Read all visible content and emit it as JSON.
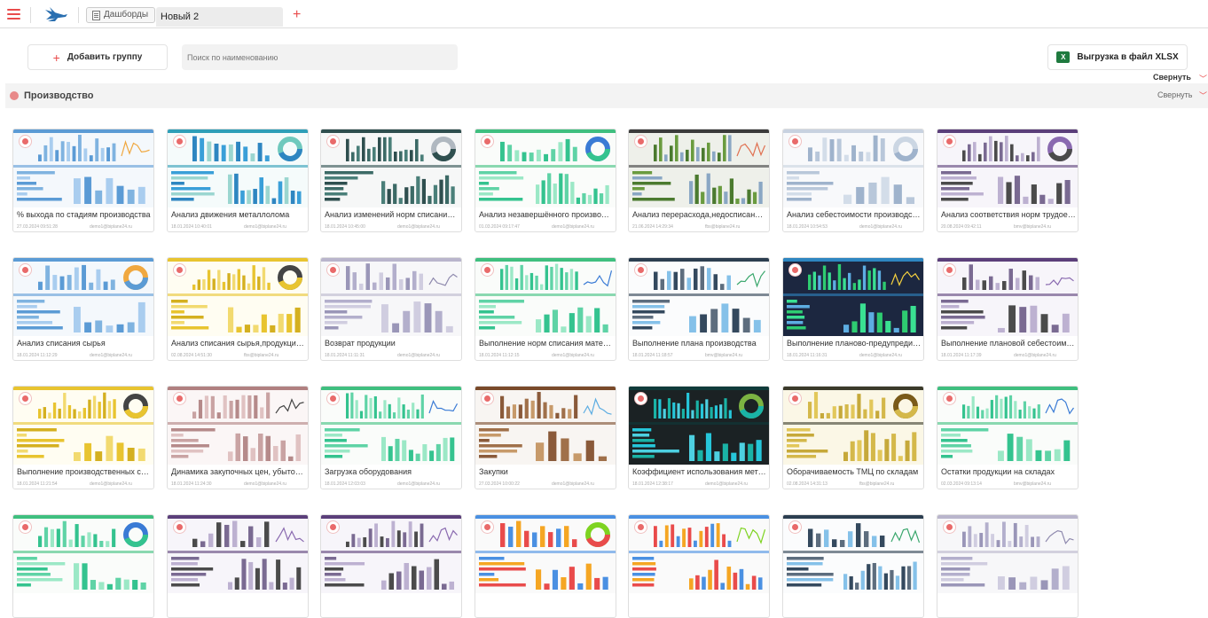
{
  "header": {
    "tabs": [
      {
        "label": "Дашборды"
      },
      {
        "label": "Новый 2"
      }
    ],
    "add_tab": "+"
  },
  "toolbar": {
    "add_group_label": "Добавить группу",
    "add_group_plus": "+",
    "search_placeholder": "Поиск по наименованию",
    "export_label": "Выгрузка в файл XLSX",
    "export_icon": "X",
    "collapse_all": "Свернуть",
    "chevron": "﹀"
  },
  "group": {
    "title": "Производство",
    "collapse": "Свернуть"
  },
  "colors": {
    "accent": "#e94b4b",
    "excel": "#1f7a3f"
  },
  "cards": [
    {
      "title": "% выхода по стадиям производства",
      "date": "27.03.2024 09:51:28",
      "author": "demo1@biplane24.ru",
      "theme": "blue"
    },
    {
      "title": "Анализ движения металлолома",
      "date": "18.01.2024 10:40:01",
      "author": "demo1@biplane24.ru",
      "theme": "teal"
    },
    {
      "title": "Анализ изменений норм списания сы...",
      "date": "18.01.2024 10:45:00",
      "author": "demo1@biplane24.ru",
      "theme": "dark"
    },
    {
      "title": "Анализ незавершённого производства",
      "date": "01.03.2024 09:17:47",
      "author": "demo1@biplane24.ru",
      "theme": "green"
    },
    {
      "title": "Анализ перерасхода,недосписания с...",
      "date": "21.06.2024 14:29:34",
      "author": "fbs@biplane24.ru",
      "theme": "olive"
    },
    {
      "title": "Анализ себестоимости производства...",
      "date": "18.01.2024 10:54:53",
      "author": "demo1@biplane24.ru",
      "theme": "light"
    },
    {
      "title": "Анализ соответствия норм трудоемк...",
      "date": "20.08.2024 09:42:11",
      "author": "bmv@biplane24.ru",
      "theme": "purple"
    },
    {
      "title": "Анализ списания сырья",
      "date": "18.01.2024 11:12:29",
      "author": "demo1@biplane24.ru",
      "theme": "blue"
    },
    {
      "title": "Анализ списания сырья,продукции с...",
      "date": "02.08.2024 14:51:30",
      "author": "fbs@biplane24.ru",
      "theme": "yellow"
    },
    {
      "title": "Возврат продукции",
      "date": "18.01.2024 11:11:31",
      "author": "demo1@biplane24.ru",
      "theme": "grey"
    },
    {
      "title": "Выполнение норм списания материа...",
      "date": "18.01.2024 11:12:15",
      "author": "demo1@biplane24.ru",
      "theme": "green"
    },
    {
      "title": "Выполнение плана производства",
      "date": "18.01.2024 11:18:57",
      "author": "bmv@biplane24.ru",
      "theme": "navy"
    },
    {
      "title": "Выполнение планово-предупредите...",
      "date": "18.01.2024 11:16:31",
      "author": "demo1@biplane24.ru",
      "theme": "darkblue"
    },
    {
      "title": "Выполнение плановой себестоимост...",
      "date": "18.01.2024 11:17:39",
      "author": "demo1@biplane24.ru",
      "theme": "purple"
    },
    {
      "title": "Выполнение производственных смен...",
      "date": "18.01.2024 11:21:54",
      "author": "demo1@biplane24.ru",
      "theme": "yellow"
    },
    {
      "title": "Динамика закупочных цен, убыток о...",
      "date": "18.01.2024 11:24:30",
      "author": "demo1@biplane24.ru",
      "theme": "pink"
    },
    {
      "title": "Загрузка оборудования",
      "date": "18.01.2024 12:03:03",
      "author": "demo1@biplane24.ru",
      "theme": "green"
    },
    {
      "title": "Закупки",
      "date": "27.03.2024 10:00:22",
      "author": "demo1@biplane24.ru",
      "theme": "brown"
    },
    {
      "title": "Коэффициент использования металла",
      "date": "18.01.2024 12:38:17",
      "author": "demo1@biplane24.ru",
      "theme": "darkteal"
    },
    {
      "title": "Оборачиваемость ТМЦ по складам",
      "date": "02.08.2024 14:31:13",
      "author": "fbs@biplane24.ru",
      "theme": "gold"
    },
    {
      "title": "Остатки продукции на складах",
      "date": "02.03.2024 09:13:14",
      "author": "bmv@biplane24.ru",
      "theme": "green"
    },
    {
      "title": "",
      "date": "",
      "author": "",
      "theme": "green"
    },
    {
      "title": "",
      "date": "",
      "author": "",
      "theme": "purple"
    },
    {
      "title": "",
      "date": "",
      "author": "",
      "theme": "purple"
    },
    {
      "title": "",
      "date": "",
      "author": "",
      "theme": "multi"
    },
    {
      "title": "",
      "date": "",
      "author": "",
      "theme": "multi"
    },
    {
      "title": "",
      "date": "",
      "author": "",
      "theme": "navy"
    },
    {
      "title": "",
      "date": "",
      "author": "",
      "theme": "grey"
    }
  ]
}
